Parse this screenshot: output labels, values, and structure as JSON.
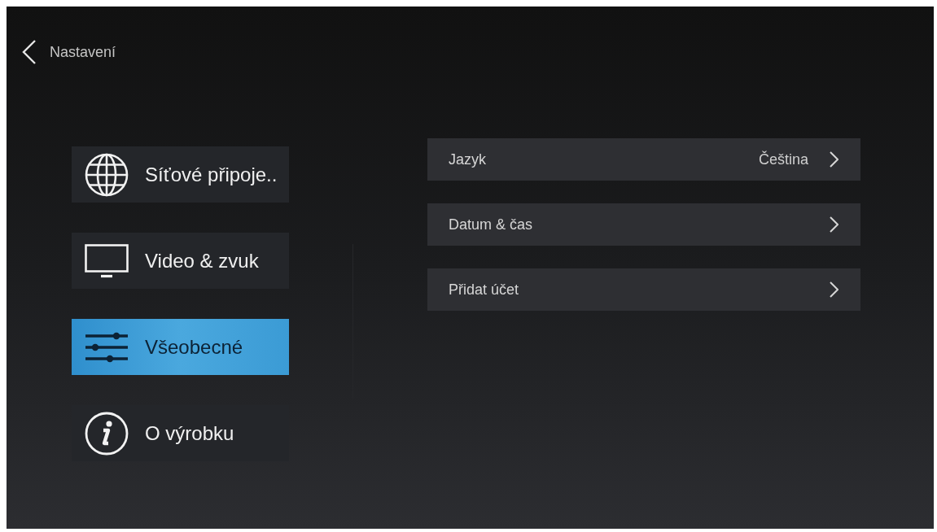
{
  "header": {
    "title": "Nastavení"
  },
  "categories": [
    {
      "kind": "globe",
      "label": "Síťové připoje..",
      "selected": false
    },
    {
      "kind": "monitor",
      "label": "Video & zvuk",
      "selected": false
    },
    {
      "kind": "sliders",
      "label": "Všeobecné",
      "selected": true
    },
    {
      "kind": "info",
      "label": "O výrobku",
      "selected": false
    }
  ],
  "settings": [
    {
      "label": "Jazyk",
      "value": "Čeština"
    },
    {
      "label": "Datum & čas"
    },
    {
      "label": "Přidat účet"
    }
  ]
}
